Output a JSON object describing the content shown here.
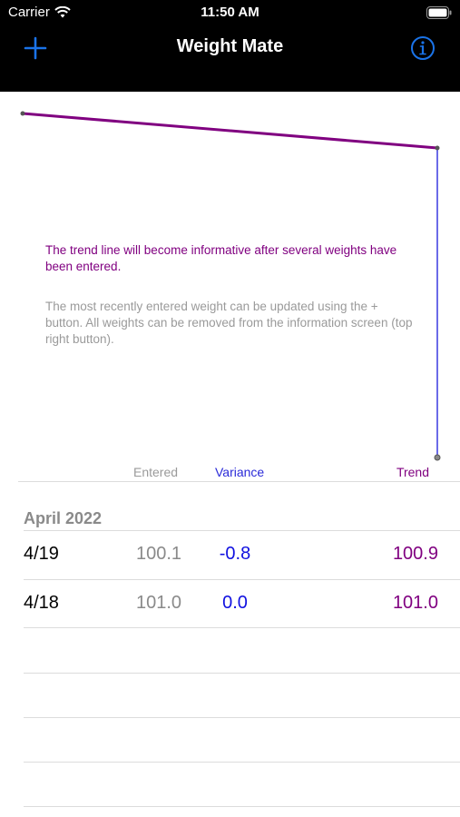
{
  "status_bar": {
    "carrier": "Carrier",
    "time": "11:50 AM"
  },
  "nav": {
    "title": "Weight Mate",
    "add_icon": "plus-icon",
    "info_icon": "info-icon"
  },
  "colors": {
    "accent": "#1a73e8",
    "trend": "#800080",
    "variance": "#1010e0",
    "muted": "#9a9a9a"
  },
  "messages": {
    "trend_note": "The trend line will become informative after several weights have been entered.",
    "help_note": "The most recently entered weight can be updated using the + button. All weights can be removed from the information screen (top right button)."
  },
  "columns": {
    "entered": "Entered",
    "variance": "Variance",
    "trend": "Trend"
  },
  "section": {
    "title": "April 2022"
  },
  "rows": [
    {
      "date": "4/19",
      "entered": "100.1",
      "variance": "-0.8",
      "trend": "100.9"
    },
    {
      "date": "4/18",
      "entered": "101.0",
      "variance": "0.0",
      "trend": "101.0"
    }
  ]
}
